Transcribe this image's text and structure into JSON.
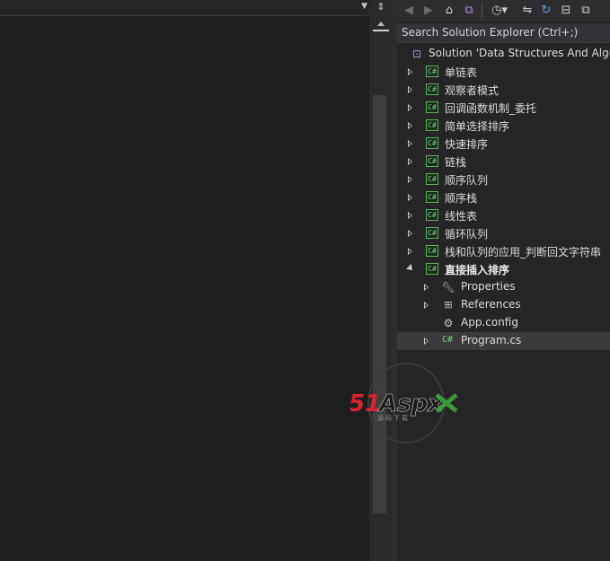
{
  "search": {
    "placeholder": "Search Solution Explorer (Ctrl+;)"
  },
  "toolbar": {
    "icons": [
      "back-icon",
      "forward-icon",
      "home-icon",
      "vs-switch-icon",
      "history-icon",
      "sync-icon",
      "refresh-icon",
      "collapse-icon",
      "copy-icon"
    ]
  },
  "tree": {
    "solution": "Solution 'Data Structures And Algo",
    "projects": [
      "单链表",
      "观察者模式",
      "回调函数机制_委托",
      "简单选择排序",
      "快速排序",
      "链栈",
      "顺序队列",
      "顺序栈",
      "线性表",
      "循环队列",
      "栈和队列的应用_判断回文字符串"
    ],
    "expanded_project": "直接插入排序",
    "children": [
      {
        "label": "Properties",
        "icon": "wrench-icon"
      },
      {
        "label": "References",
        "icon": "references-icon"
      },
      {
        "label": "App.config",
        "icon": "config-file-icon"
      },
      {
        "label": "Program.cs",
        "icon": "csharp-file-icon"
      }
    ]
  },
  "watermark": {
    "text": "51Aspx",
    "subtext": "源码下载"
  },
  "colors": {
    "csharp_green": "#58b85a",
    "watermark_red": "#d8242a",
    "watermark_green": "#3a9a3a"
  }
}
